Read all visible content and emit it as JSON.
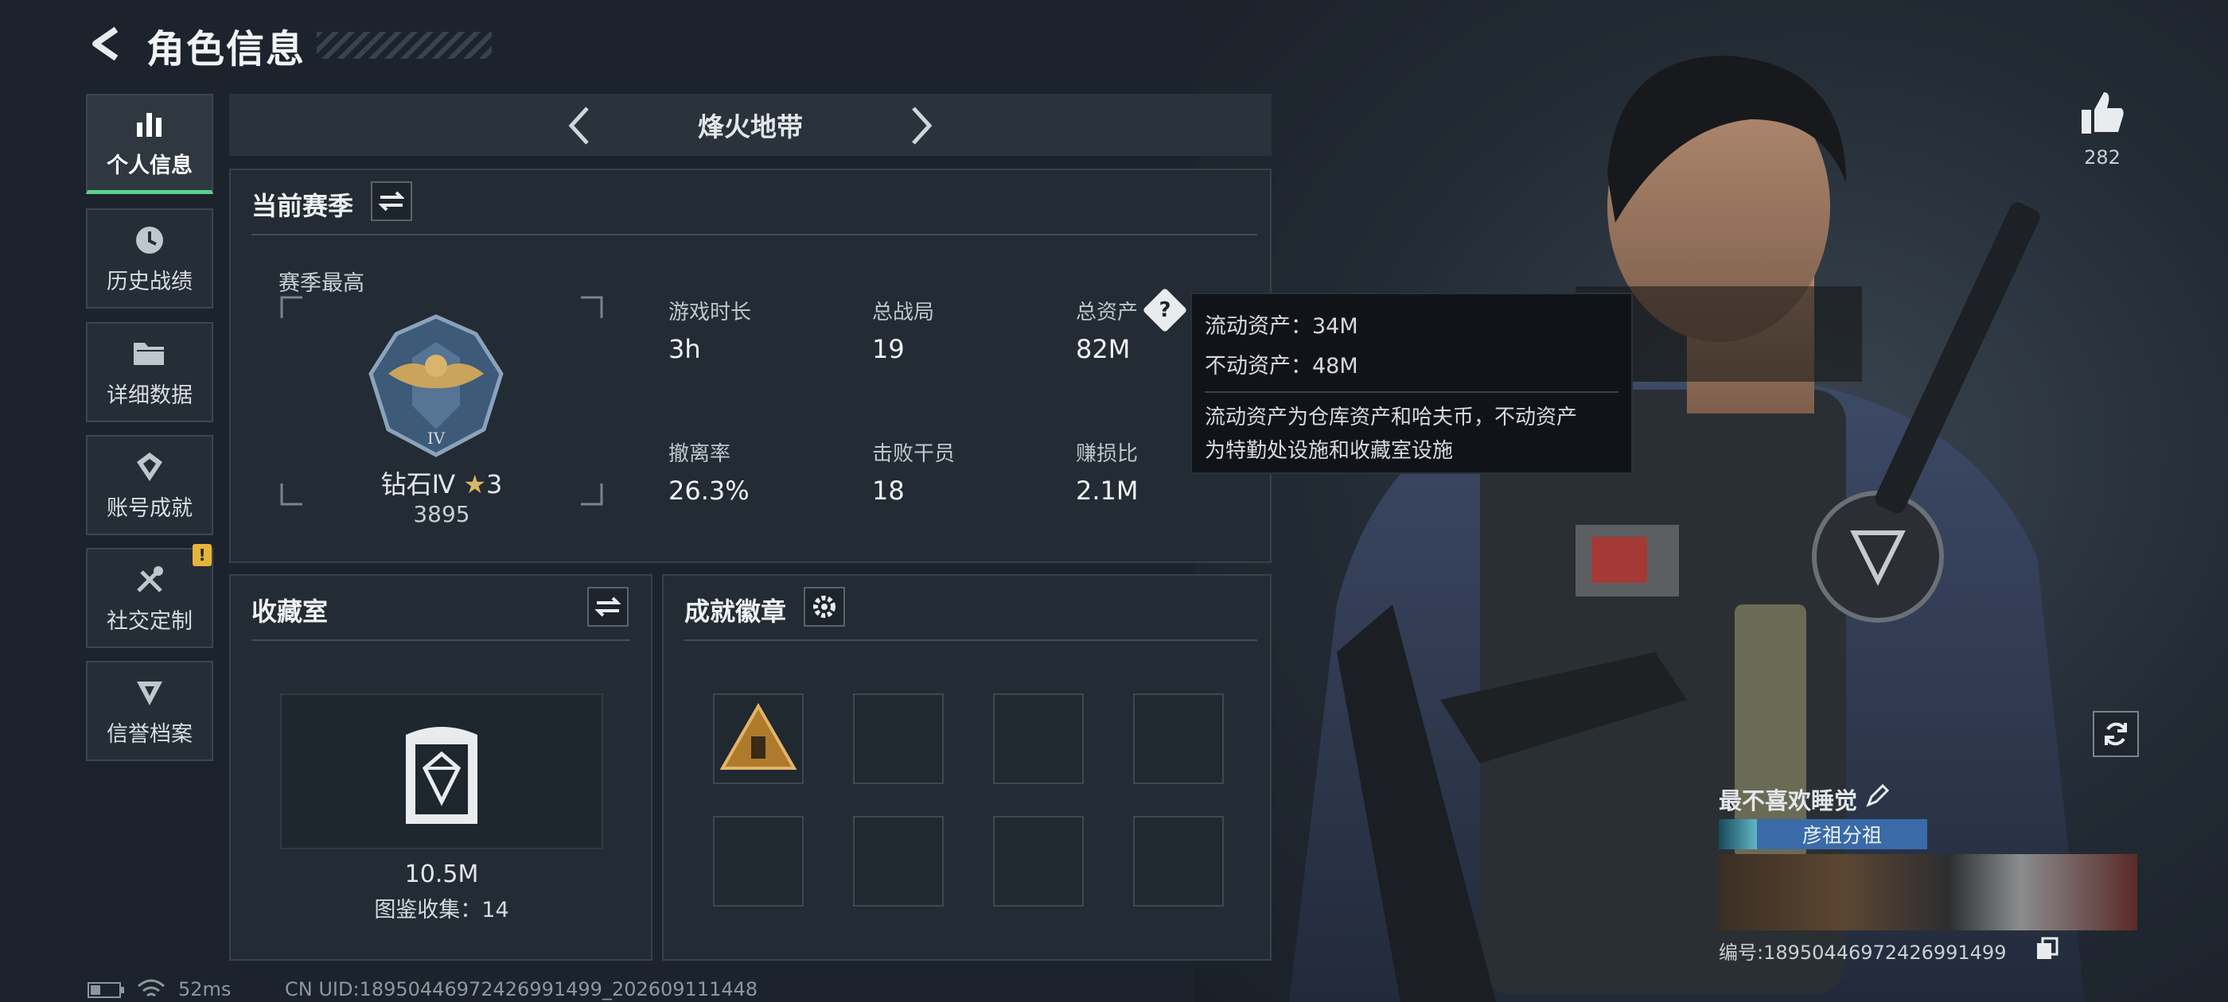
{
  "header": {
    "title": "角色信息"
  },
  "nav": [
    {
      "label": "个人信息",
      "icon": "bar-chart-icon",
      "active": true
    },
    {
      "label": "历史战绩",
      "icon": "clock-icon"
    },
    {
      "label": "详细数据",
      "icon": "folder-icon"
    },
    {
      "label": "账号成就",
      "icon": "achievement-icon"
    },
    {
      "label": "社交定制",
      "icon": "tools-icon",
      "badge": "!"
    },
    {
      "label": "信誉档案",
      "icon": "shield-icon"
    }
  ],
  "mode": {
    "name": "烽火地带"
  },
  "season": {
    "title": "当前赛季",
    "best_label": "赛季最高",
    "rank": "钻石Ⅳ",
    "stars": "3",
    "score": "3895",
    "stats": [
      {
        "label": "游戏时长",
        "value": "3h"
      },
      {
        "label": "总战局",
        "value": "19"
      },
      {
        "label": "总资产",
        "value": "82M"
      },
      {
        "label": "撤离率",
        "value": "26.3%"
      },
      {
        "label": "击败干员",
        "value": "18"
      },
      {
        "label": "赚损比",
        "value": "2.1M"
      }
    ]
  },
  "tooltip": {
    "liquid": "流动资产：34M",
    "fixed": "不动资产：48M",
    "desc_1": "流动资产为仓库资产和哈夫币，不动资产",
    "desc_2": "为特勤处设施和收藏室设施"
  },
  "collection": {
    "title": "收藏室",
    "value": "10.5M",
    "collected": "图鉴收集：14"
  },
  "achievements": {
    "title": "成就徽章"
  },
  "player": {
    "name": "最不喜欢睡觉",
    "tag": "彦祖分祖",
    "id": "编号:18950446972426991499"
  },
  "likes": {
    "count": "282"
  },
  "status": {
    "ping": "52ms",
    "uid": "CN UID:18950446972426991499_202609111448"
  },
  "colors": {
    "accent": "#5ccf8e",
    "warning": "#e4b53a",
    "background": "#1c232c"
  }
}
